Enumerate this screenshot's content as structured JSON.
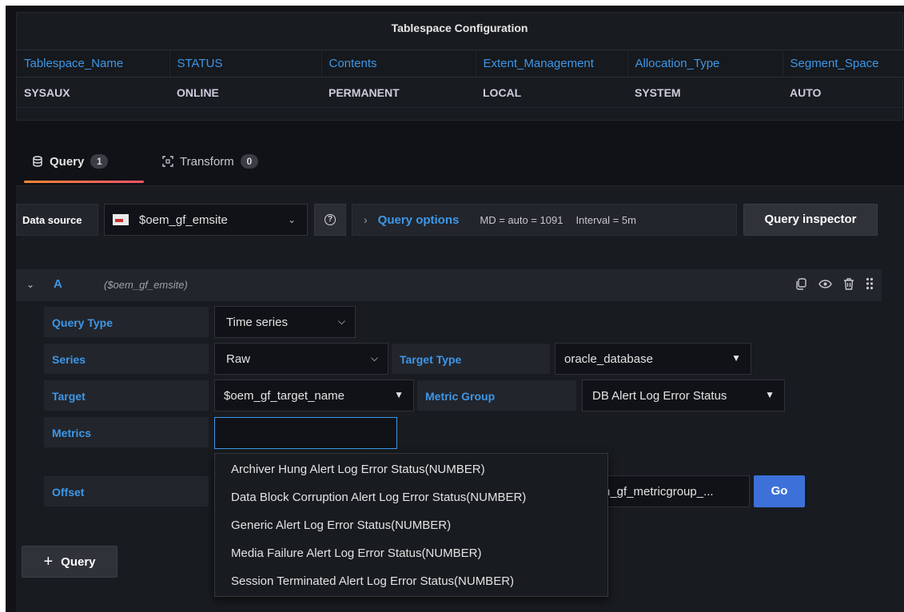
{
  "table_panel": {
    "title": "Tablespace Configuration",
    "columns": [
      "Tablespace_Name",
      "STATUS",
      "Contents",
      "Extent_Management",
      "Allocation_Type",
      "Segment_Space"
    ],
    "rows": [
      [
        "SYSAUX",
        "ONLINE",
        "PERMANENT",
        "LOCAL",
        "SYSTEM",
        "AUTO"
      ]
    ]
  },
  "tabs": [
    {
      "label": "Query",
      "count": "1",
      "icon": "database-icon"
    },
    {
      "label": "Transform",
      "count": "0",
      "icon": "transform-icon"
    }
  ],
  "datasource": {
    "label": "Data source",
    "value": "$oem_gf_emsite",
    "help_icon": "question-circle-icon"
  },
  "query_options": {
    "title": "Query options",
    "md": "MD = auto = 1091",
    "interval": "Interval = 5m"
  },
  "query_inspector_label": "Query inspector",
  "query": {
    "name": "A",
    "datasource": "($oem_gf_emsite)",
    "actions": [
      "duplicate-icon",
      "eye-icon",
      "trash-icon",
      "drag-handle-icon"
    ]
  },
  "form": {
    "query_type_label": "Query Type",
    "query_type_value": "Time series",
    "series_label": "Series",
    "series_value": "Raw",
    "target_type_label": "Target Type",
    "target_type_value": "oracle_database",
    "target_label": "Target",
    "target_value": "$oem_gf_target_name",
    "metric_group_label": "Metric Group",
    "metric_group_value": "DB Alert Log Error Status",
    "metrics_label": "Metrics",
    "metrics_value": "",
    "offset_label": "Offset",
    "hidden_field_value": "n_gf_metricgroup_..."
  },
  "metric_options": [
    "Archiver Hung Alert Log Error Status(NUMBER)",
    "Data Block Corruption Alert Log Error Status(NUMBER)",
    "Generic Alert Log Error Status(NUMBER)",
    "Media Failure Alert Log Error Status(NUMBER)",
    "Session Terminated Alert Log Error Status(NUMBER)"
  ],
  "go_label": "Go",
  "add_query_label": "Query",
  "colors": {
    "accent_blue": "#3e97e9",
    "go_button": "#3d71d9",
    "tab_underline_start": "#ff8833",
    "tab_underline_end": "#f5536a",
    "background": "#111217",
    "panel": "#181b1f"
  }
}
